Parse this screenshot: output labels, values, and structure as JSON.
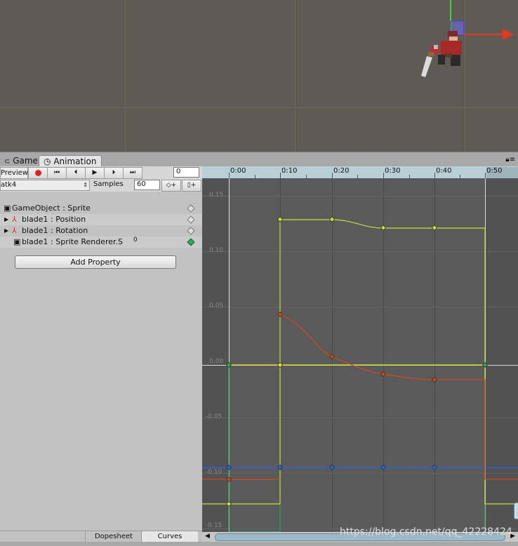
{
  "tabs": [
    {
      "label": "Game",
      "icon": "game-icon"
    },
    {
      "label": "Animation",
      "icon": "clock-icon",
      "active": true
    }
  ],
  "toolbar": {
    "preview_label": "Preview",
    "record": "record-icon",
    "frame_value": "0",
    "clip_name": "atk4",
    "samples_label": "Samples",
    "samples_value": "60"
  },
  "properties": [
    {
      "label": "GameObject : Sprite",
      "icon": "sprite-icon",
      "expandable": false
    },
    {
      "label": "blade1 : Position",
      "icon": "transform-icon",
      "expandable": true
    },
    {
      "label": "blade1 : Rotation",
      "icon": "transform-icon",
      "expandable": true
    },
    {
      "label": "blade1 : Sprite Renderer.S",
      "icon": "sprite-icon",
      "expandable": false,
      "value": "0"
    }
  ],
  "add_property_label": "Add Property",
  "bottom_tabs": [
    "Dopesheet",
    "Curves"
  ],
  "ruler": {
    "ticks": [
      "0:00",
      "0:10",
      "0:20",
      "0:30",
      "0:40",
      "0:50"
    ]
  },
  "curves_axis": {
    "labels": [
      "0.15",
      "0.10",
      "0.05",
      "0.00",
      "-0.05",
      "-0.10",
      "-0.15"
    ]
  },
  "colors": {
    "curve_yellow": "#c8e03a",
    "curve_red": "#d04a1e",
    "curve_blue": "#2f62d8",
    "curve_green": "#2ea85a",
    "ruler_bg": "#b7cfd5"
  },
  "watermark": "https://blog.csdn.net/qq_42228424"
}
